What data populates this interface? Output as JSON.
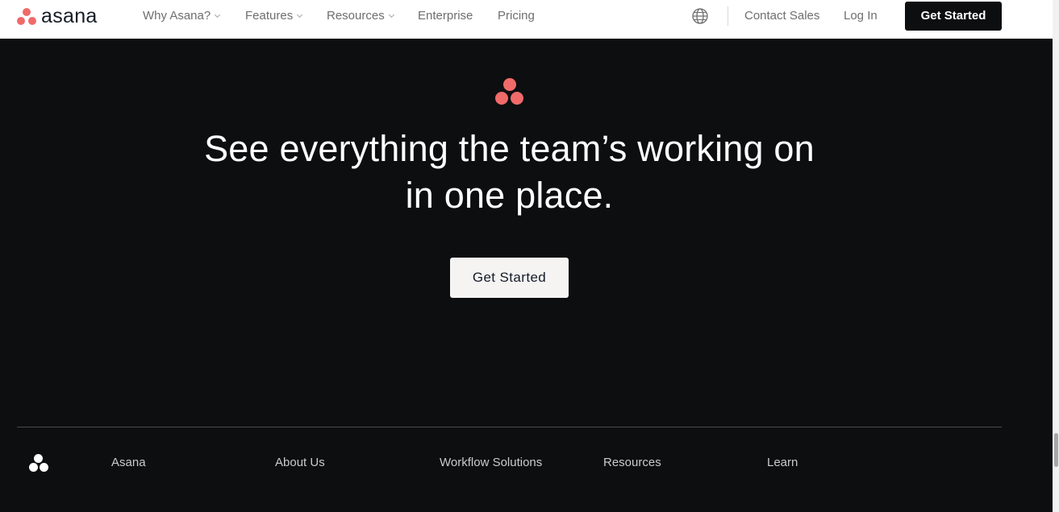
{
  "colors": {
    "brand_coral": "#f06a6a",
    "hero_background": "#0d0e10",
    "nav_background": "#ffffff",
    "nav_cta_background": "#0d0e10",
    "hero_cta_background": "#f5f4f3"
  },
  "nav": {
    "logo_text": "asana",
    "items": [
      {
        "label": "Why Asana?",
        "has_dropdown": true
      },
      {
        "label": "Features",
        "has_dropdown": true
      },
      {
        "label": "Resources",
        "has_dropdown": true
      },
      {
        "label": "Enterprise",
        "has_dropdown": false
      },
      {
        "label": "Pricing",
        "has_dropdown": false
      }
    ],
    "language_icon": "globe-icon",
    "contact_sales": "Contact Sales",
    "log_in": "Log In",
    "cta": "Get Started"
  },
  "hero": {
    "logo_icon": "asana-logo-icon",
    "headline_line1": "See everything the team’s working on",
    "headline_line2": "in one place.",
    "cta": "Get Started"
  },
  "footer": {
    "logo_icon": "asana-logo-icon",
    "headings": [
      "Asana",
      "About Us",
      "Workflow Solutions",
      "Resources",
      "Learn"
    ]
  }
}
